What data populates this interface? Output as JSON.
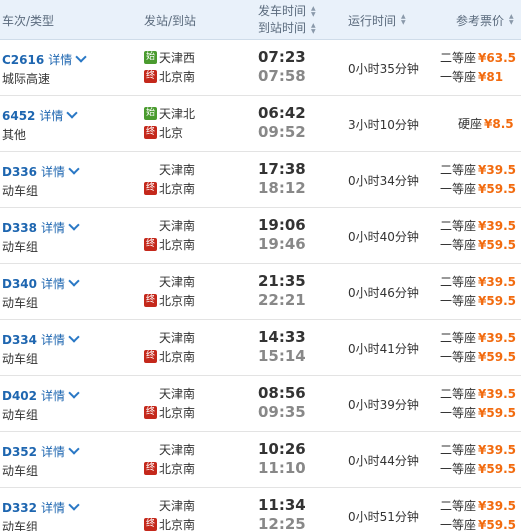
{
  "header": {
    "col_train": "车次/类型",
    "col_station": "发站/到站",
    "col_dep": "发车时间",
    "col_arr": "到站时间",
    "col_duration": "运行时间",
    "col_price": "参考票价",
    "sort_icon": "sort-arrows-icon"
  },
  "station_icons": {
    "origin": "始",
    "dest": "终"
  },
  "rows": [
    {
      "no": "C2616",
      "detail": "详情",
      "type": "城际高速",
      "from": "天津西",
      "from_origin": true,
      "to": "北京南",
      "to_dest": true,
      "dep": "07:23",
      "arr": "07:58",
      "duration": "0小时35分钟",
      "prices": [
        {
          "seat": "二等座",
          "amt": "¥63.5"
        },
        {
          "seat": "一等座",
          "amt": "¥81"
        }
      ]
    },
    {
      "no": "6452",
      "detail": "详情",
      "type": "其他",
      "from": "天津北",
      "from_origin": true,
      "to": "北京",
      "to_dest": true,
      "dep": "06:42",
      "arr": "09:52",
      "duration": "3小时10分钟",
      "prices": [
        {
          "seat": "硬座",
          "amt": "¥8.5"
        }
      ]
    },
    {
      "no": "D336",
      "detail": "详情",
      "type": "动车组",
      "from": "天津南",
      "from_origin": false,
      "to": "北京南",
      "to_dest": true,
      "dep": "17:38",
      "arr": "18:12",
      "duration": "0小时34分钟",
      "prices": [
        {
          "seat": "二等座",
          "amt": "¥39.5"
        },
        {
          "seat": "一等座",
          "amt": "¥59.5"
        }
      ]
    },
    {
      "no": "D338",
      "detail": "详情",
      "type": "动车组",
      "from": "天津南",
      "from_origin": false,
      "to": "北京南",
      "to_dest": true,
      "dep": "19:06",
      "arr": "19:46",
      "duration": "0小时40分钟",
      "prices": [
        {
          "seat": "二等座",
          "amt": "¥39.5"
        },
        {
          "seat": "一等座",
          "amt": "¥59.5"
        }
      ]
    },
    {
      "no": "D340",
      "detail": "详情",
      "type": "动车组",
      "from": "天津南",
      "from_origin": false,
      "to": "北京南",
      "to_dest": true,
      "dep": "21:35",
      "arr": "22:21",
      "duration": "0小时46分钟",
      "prices": [
        {
          "seat": "二等座",
          "amt": "¥39.5"
        },
        {
          "seat": "一等座",
          "amt": "¥59.5"
        }
      ]
    },
    {
      "no": "D334",
      "detail": "详情",
      "type": "动车组",
      "from": "天津南",
      "from_origin": false,
      "to": "北京南",
      "to_dest": true,
      "dep": "14:33",
      "arr": "15:14",
      "duration": "0小时41分钟",
      "prices": [
        {
          "seat": "二等座",
          "amt": "¥39.5"
        },
        {
          "seat": "一等座",
          "amt": "¥59.5"
        }
      ]
    },
    {
      "no": "D402",
      "detail": "详情",
      "type": "动车组",
      "from": "天津南",
      "from_origin": false,
      "to": "北京南",
      "to_dest": true,
      "dep": "08:56",
      "arr": "09:35",
      "duration": "0小时39分钟",
      "prices": [
        {
          "seat": "二等座",
          "amt": "¥39.5"
        },
        {
          "seat": "一等座",
          "amt": "¥59.5"
        }
      ]
    },
    {
      "no": "D352",
      "detail": "详情",
      "type": "动车组",
      "from": "天津南",
      "from_origin": false,
      "to": "北京南",
      "to_dest": true,
      "dep": "10:26",
      "arr": "11:10",
      "duration": "0小时44分钟",
      "prices": [
        {
          "seat": "二等座",
          "amt": "¥39.5"
        },
        {
          "seat": "一等座",
          "amt": "¥59.5"
        }
      ]
    },
    {
      "no": "D332",
      "detail": "详情",
      "type": "动车组",
      "from": "天津南",
      "from_origin": false,
      "to": "北京南",
      "to_dest": true,
      "dep": "11:34",
      "arr": "12:25",
      "duration": "0小时51分钟",
      "prices": [
        {
          "seat": "二等座",
          "amt": "¥39.5"
        },
        {
          "seat": "一等座",
          "amt": "¥59.5"
        }
      ]
    }
  ],
  "colors": {
    "header_bg": "#e9f1fa",
    "link": "#1e66b0",
    "price": "#f26b0f",
    "origin_icon": "#4a9b2f",
    "dest_icon": "#c4281b"
  }
}
